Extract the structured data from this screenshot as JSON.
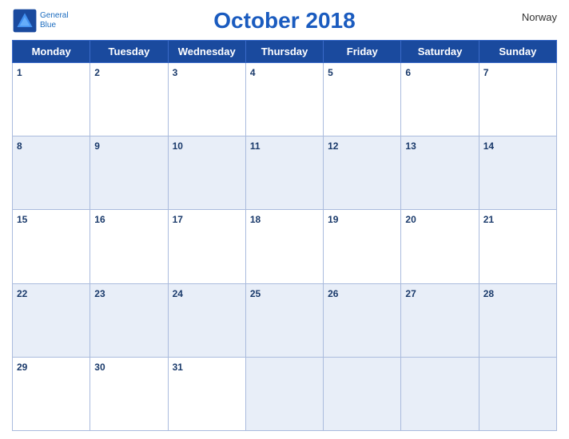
{
  "header": {
    "title": "October 2018",
    "country": "Norway",
    "logo_general": "General",
    "logo_blue": "Blue"
  },
  "weekdays": [
    "Monday",
    "Tuesday",
    "Wednesday",
    "Thursday",
    "Friday",
    "Saturday",
    "Sunday"
  ],
  "weeks": [
    [
      1,
      2,
      3,
      4,
      5,
      6,
      7
    ],
    [
      8,
      9,
      10,
      11,
      12,
      13,
      14
    ],
    [
      15,
      16,
      17,
      18,
      19,
      20,
      21
    ],
    [
      22,
      23,
      24,
      25,
      26,
      27,
      28
    ],
    [
      29,
      30,
      31,
      null,
      null,
      null,
      null
    ]
  ],
  "colors": {
    "header_bg": "#1a4a9e",
    "title_color": "#1a5bbf",
    "day_num_color": "#1a3a6b",
    "row_even_bg": "#e8eef8"
  }
}
